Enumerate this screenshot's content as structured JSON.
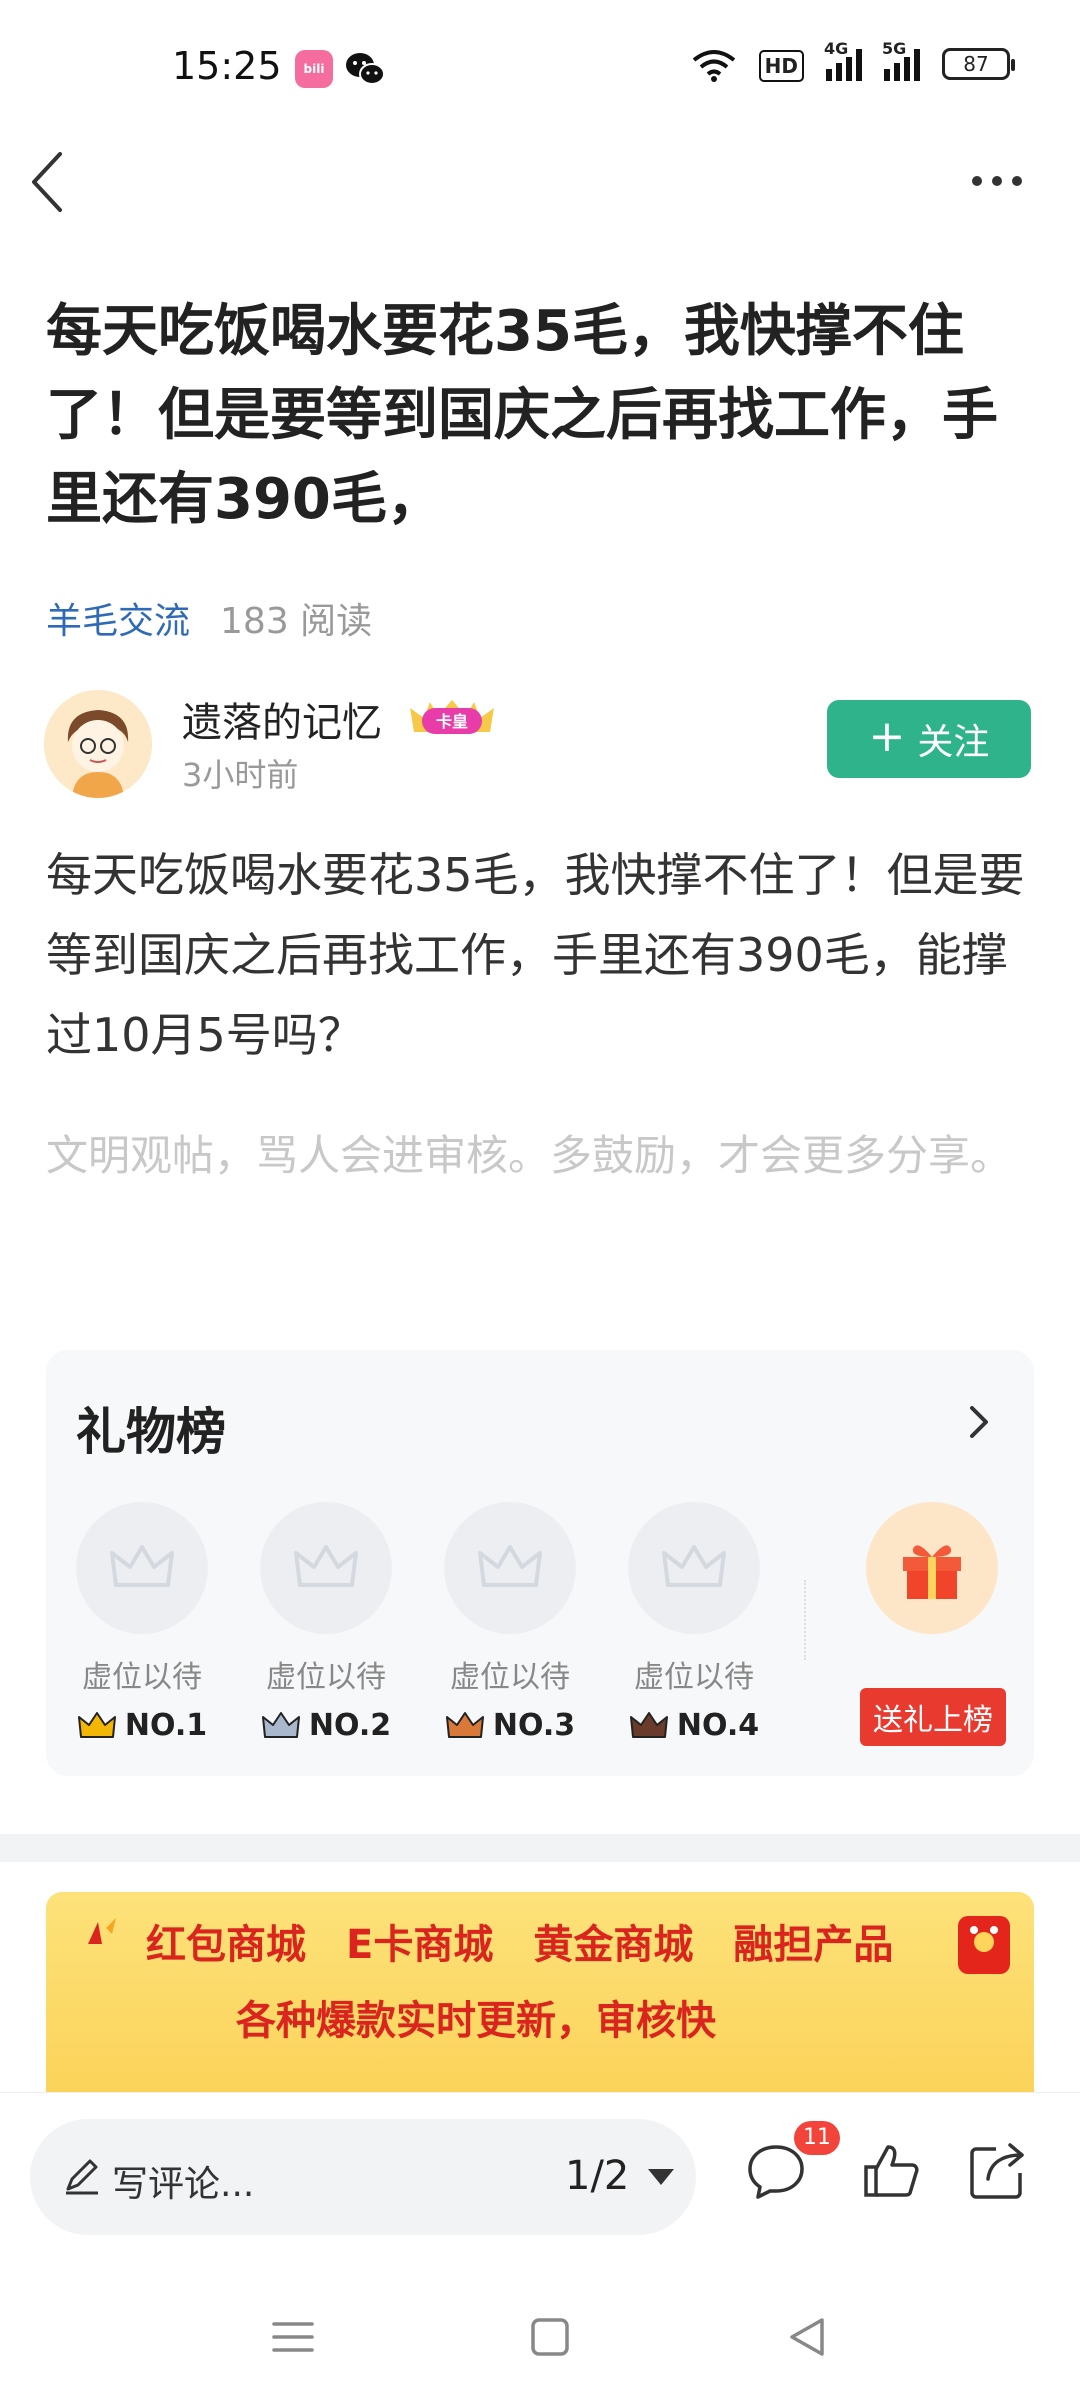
{
  "status_bar": {
    "time": "15:25",
    "hd_label": "HD",
    "signal1_label": "4G",
    "signal2_label": "5G",
    "battery": "87"
  },
  "post": {
    "title": "每天吃饭喝水要花35毛，我快撑不住了！但是要等到国庆之后再找工作，手里还有390毛，",
    "topic": "羊毛交流",
    "reads": "183 阅读",
    "author_name": "遗落的记忆",
    "author_badge": "卡皇",
    "author_time": "3小时前",
    "follow_label": "关注",
    "body": "每天吃饭喝水要花35毛，我快撑不住了！但是要等到国庆之后再找工作，手里还有390毛，能撑过10月5号吗？",
    "hint": "文明观帖，骂人会进审核。多鼓励，才会更多分享。"
  },
  "gift_board": {
    "title": "礼物榜",
    "slots": [
      {
        "label": "虚位以待",
        "rank": "NO.1",
        "crown_color": "#f2b705"
      },
      {
        "label": "虚位以待",
        "rank": "NO.2",
        "crown_color": "#7c8ea8"
      },
      {
        "label": "虚位以待",
        "rank": "NO.3",
        "crown_color": "#d8793a"
      },
      {
        "label": "虚位以待",
        "rank": "NO.4",
        "crown_color": "#6a3b2a"
      }
    ],
    "send_label": "送礼上榜"
  },
  "ad": {
    "row1": [
      "红包商城",
      "E卡商城",
      "黄金商城",
      "融担产品"
    ],
    "row2": "各种爆款实时更新，审核快"
  },
  "bottom_bar": {
    "comment_placeholder": "写评论...",
    "page_indicator": "1/2",
    "comment_count": "11"
  },
  "colors": {
    "follow_bg": "#2fb38a",
    "topic": "#2f6ab8",
    "send_gift_bg": "#e93a30",
    "badge_red": "#f2443a"
  }
}
